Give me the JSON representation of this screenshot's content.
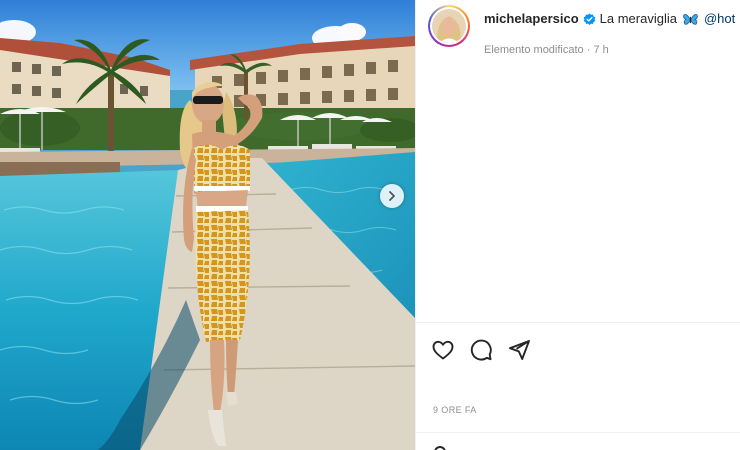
{
  "post": {
    "username": "michelapersico",
    "verified": true,
    "caption_text": "La meraviglia",
    "caption_emoji_icon": "butterfly-icon",
    "mention": "@hot",
    "edited_label": "Elemento modificato",
    "edited_time": "7 h",
    "timestamp": "9 ORE FA"
  },
  "actions": {
    "like_icon": "heart-icon",
    "comment_icon": "comment-icon",
    "share_icon": "paper-plane-icon"
  },
  "carousel": {
    "next_icon": "chevron-right-icon"
  },
  "colors": {
    "verified_blue": "#0095f6",
    "mention_blue": "#00376b",
    "muted_text": "#8e8e8e",
    "pool_water": "#1fa9c8",
    "sky": "#3f8fe0"
  }
}
